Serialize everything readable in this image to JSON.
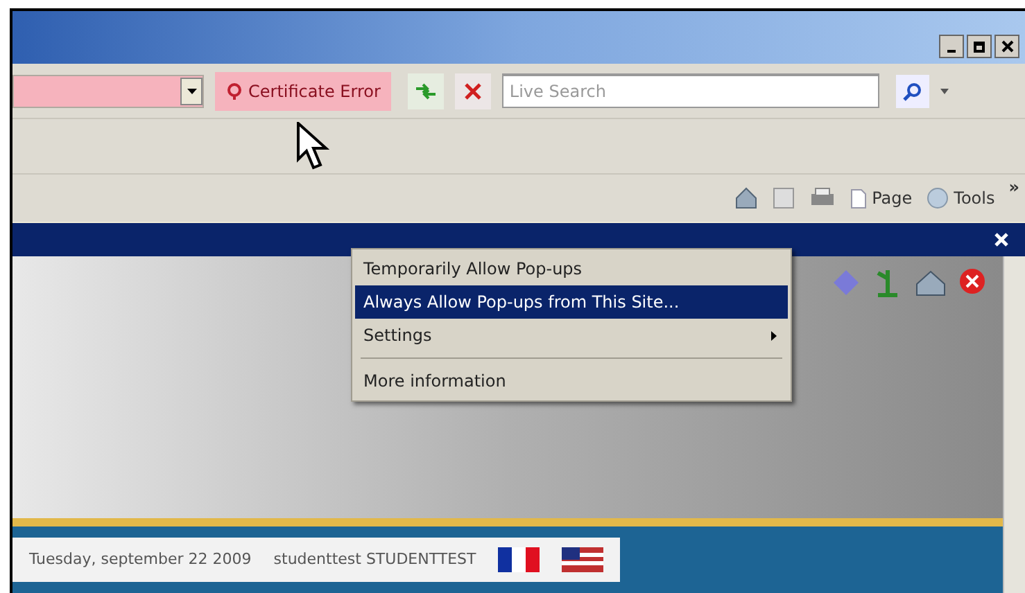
{
  "address_bar": {
    "error": true
  },
  "certificate_error": {
    "label": "Certificate Error"
  },
  "search": {
    "placeholder": "Live Search"
  },
  "command_bar": {
    "buttons": [
      "Page",
      "Tools"
    ],
    "overflow": "»"
  },
  "context_menu": {
    "items": [
      {
        "kind": "item",
        "label": "Temporarily Allow Pop-ups",
        "selected": false,
        "submenu": false
      },
      {
        "kind": "item",
        "label": "Always Allow Pop-ups from This Site...",
        "selected": true,
        "submenu": false
      },
      {
        "kind": "item",
        "label": "Settings",
        "selected": false,
        "submenu": true
      },
      {
        "kind": "separator"
      },
      {
        "kind": "item",
        "label": "More information",
        "selected": false,
        "submenu": false
      }
    ]
  },
  "status_strip": {
    "date": "Tuesday, september 22 2009",
    "user": "studenttest STUDENTTEST"
  }
}
